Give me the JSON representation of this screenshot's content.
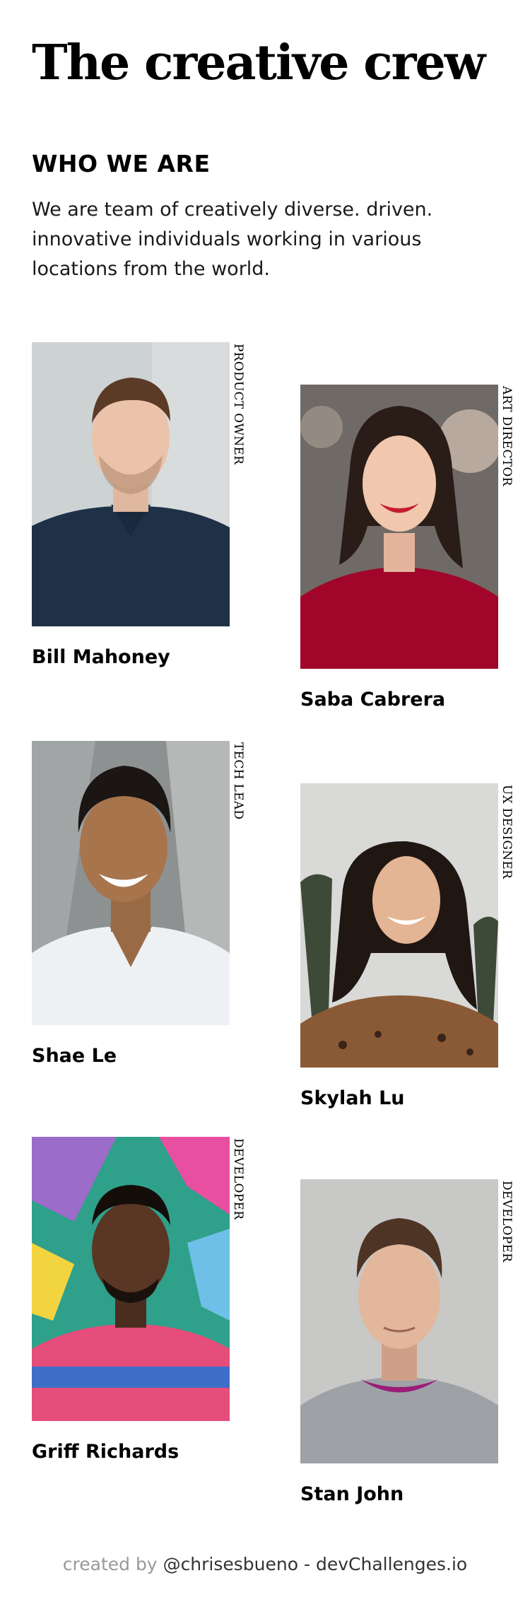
{
  "page": {
    "title": "The creative crew",
    "section_heading": "WHO WE ARE",
    "intro": "We are team of creatively diverse. driven. innovative individuals working in various locations from the world."
  },
  "members": [
    {
      "name": "Bill Mahoney",
      "role": "PRODUCT OWNER",
      "photo_description": "man with short brown hair in navy polo shirt"
    },
    {
      "name": "Saba Cabrera",
      "role": "ART DIRECTOR",
      "photo_description": "smiling woman with dark hair in red sweater"
    },
    {
      "name": "Shae Le",
      "role": "TECH LEAD",
      "photo_description": "smiling man with dark hair in white t-shirt"
    },
    {
      "name": "Skylah Lu",
      "role": "UX DESIGNER",
      "photo_description": "laughing woman with long dark hair, palm trees"
    },
    {
      "name": "Griff Richards",
      "role": "DEVELOPER",
      "photo_description": "man in striped shirt in front of graffiti wall"
    },
    {
      "name": "Stan John",
      "role": "DEVELOPER",
      "photo_description": "man in grey sweatshirt with short hair"
    }
  ],
  "footer": {
    "prefix": "created by",
    "author": "@chrisesbueno",
    "separator": " - ",
    "site": "devChallenges.io"
  },
  "colors": {
    "background": "#ffffff",
    "text": "#000000",
    "footer_muted": "#999999"
  }
}
